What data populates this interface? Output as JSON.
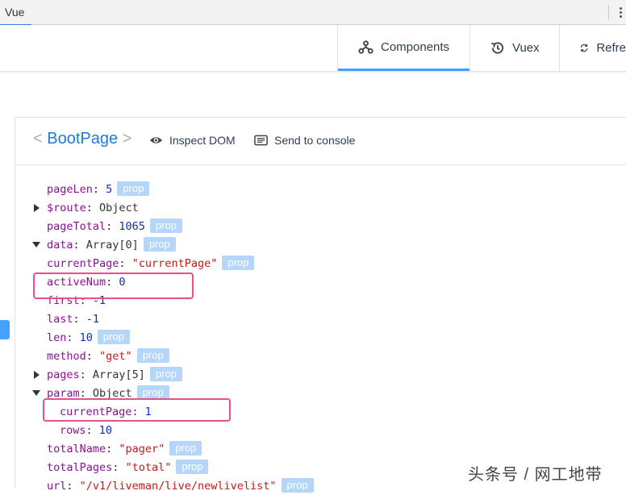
{
  "devtools": {
    "tab_label": "Vue"
  },
  "toolbar": {
    "components": "Components",
    "vuex": "Vuex",
    "refresh": "Refre"
  },
  "header": {
    "lt": "<",
    "component_name": "BootPage",
    "gt": ">",
    "inspect_dom": "Inspect DOM",
    "send_to_console": "Send to console"
  },
  "tree": {
    "prop_tag": "prop",
    "rows": [
      {
        "key": "pageLen",
        "value": "5",
        "value_type": "num",
        "prop": true
      },
      {
        "key": "$route",
        "value": "Object",
        "value_type": "obj",
        "prop": false,
        "toggle": "collapsed"
      },
      {
        "key": "pageTotal",
        "value": "1065",
        "value_type": "num",
        "prop": true
      },
      {
        "key": "data",
        "value": "Array[0]",
        "value_type": "obj",
        "prop": true,
        "toggle": "expanded"
      },
      {
        "key": "currentPage",
        "value": "\"currentPage\"",
        "value_type": "str",
        "prop": true
      },
      {
        "key": "activeNum",
        "value": "0",
        "value_type": "num",
        "prop": false
      },
      {
        "key": "first",
        "value": "-1",
        "value_type": "num",
        "prop": false
      },
      {
        "key": "last",
        "value": "-1",
        "value_type": "num",
        "prop": false
      },
      {
        "key": "len",
        "value": "10",
        "value_type": "num",
        "prop": true
      },
      {
        "key": "method",
        "value": "\"get\"",
        "value_type": "str",
        "prop": true
      },
      {
        "key": "pages",
        "value": "Array[5]",
        "value_type": "obj",
        "prop": true,
        "toggle": "collapsed"
      },
      {
        "key": "param",
        "value": "Object",
        "value_type": "obj",
        "prop": true,
        "toggle": "expanded"
      },
      {
        "key": "currentPage",
        "value": "1",
        "value_type": "num",
        "prop": false
      },
      {
        "key": "rows",
        "value": "10",
        "value_type": "num",
        "prop": false
      },
      {
        "key": "totalName",
        "value": "\"pager\"",
        "value_type": "str",
        "prop": true
      },
      {
        "key": "totalPages",
        "value": "\"total\"",
        "value_type": "str",
        "prop": true
      },
      {
        "key": "url",
        "value": "\"/v1/liveman/live/newlivelist\"",
        "value_type": "str",
        "prop": true
      }
    ]
  },
  "watermark": "头条号 / 网工地带",
  "colors": {
    "accent": "#44a1ff",
    "highlight": "#e94f8a",
    "prop_badge": "#b4d6f8"
  }
}
